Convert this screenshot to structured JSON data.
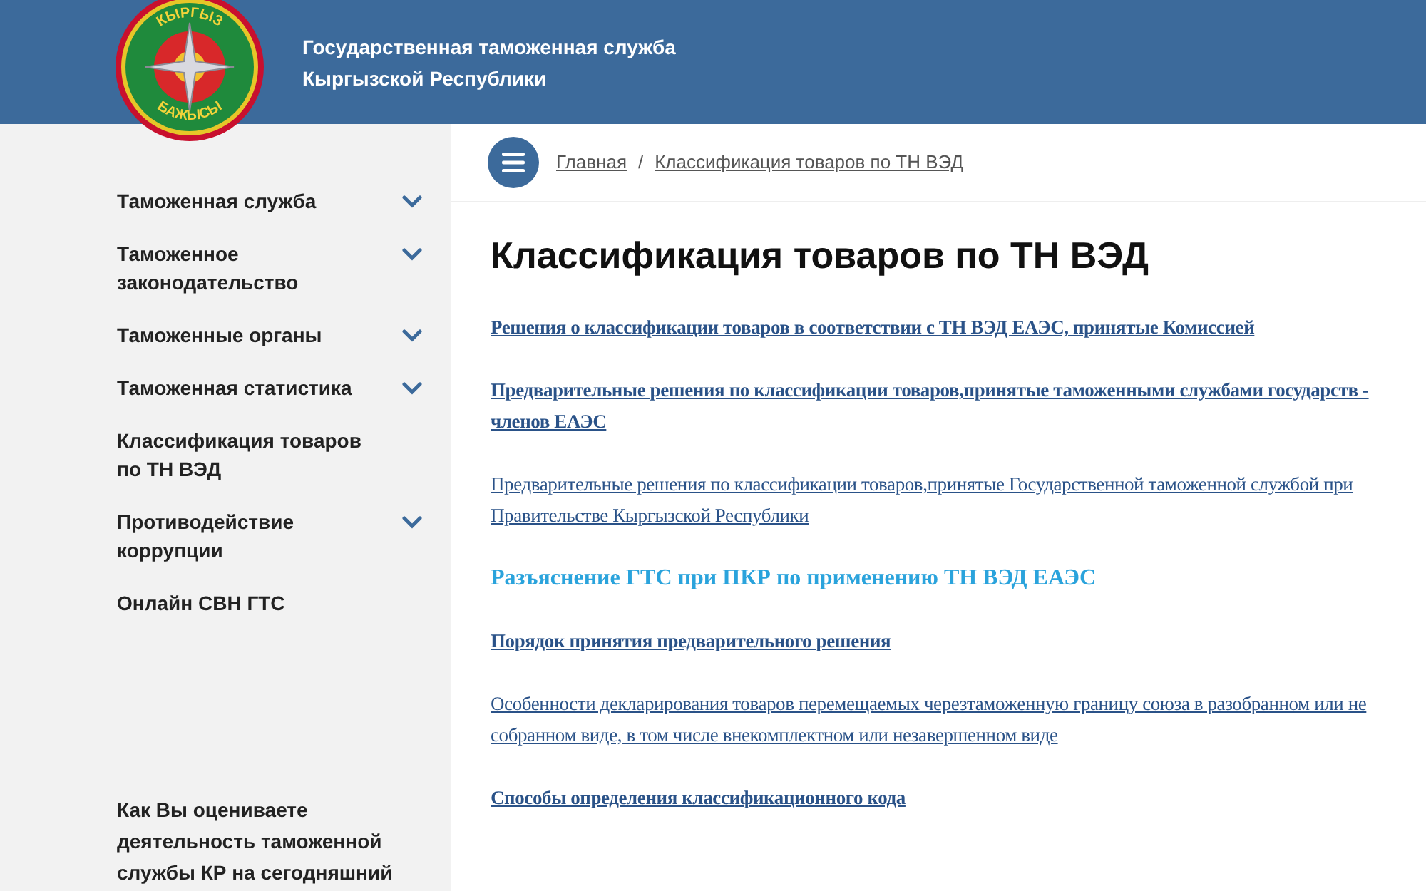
{
  "header": {
    "logo": {
      "top_text": "КЫРГЫЗ",
      "bottom_text": "БАЖЫСЫ"
    },
    "title_lines": [
      "Государственная таможенная служба",
      "Кыргызской Республики"
    ]
  },
  "sidebar": {
    "items": [
      {
        "label": "Таможенная служба",
        "expandable": true
      },
      {
        "label": "Таможенное законодательство",
        "expandable": true
      },
      {
        "label": "Таможенные органы",
        "expandable": true
      },
      {
        "label": "Таможенная статистика",
        "expandable": true
      },
      {
        "label": "Классификация товаров по ТН ВЭД",
        "expandable": false
      },
      {
        "label": "Противодействие коррупции",
        "expandable": true
      },
      {
        "label": "Онлайн СВН ГТС",
        "expandable": false
      }
    ],
    "poll_question": "Как Вы оцениваете деятельность таможенной службы КР на сегодняшний"
  },
  "breadcrumbs": [
    "Главная",
    "Классификация товаров по ТН ВЭД"
  ],
  "breadcrumb_separator": "/",
  "page_title": "Классификация товаров по ТН ВЭД",
  "links": [
    {
      "kind": "bold",
      "text": "Решения о классификации товаров в соответствии с ТН ВЭД ЕАЭС, принятые Комиссией"
    },
    {
      "kind": "bold",
      "text": "Предварительные решения по классификации товаров,принятые таможенными службами государств - членов ЕАЭС"
    },
    {
      "kind": "regular",
      "text": "Предварительные решения по классификации товаров,принятые Государственной таможенной службой при Правительстве Кыргызской Республики"
    },
    {
      "kind": "heading",
      "text": "Разъяснение ГТС при ПКР по применению ТН ВЭД ЕАЭС"
    },
    {
      "kind": "bold",
      "text": "Порядок принятия предварительного решения"
    },
    {
      "kind": "regular",
      "text": "Особенности декларирования товаров перемещаемых черезтаможенную границу союза в разобранном или не собранном виде, в том числе внекомплектном или незавершенном виде"
    },
    {
      "kind": "bold",
      "text": "Способы определения классификационного кода"
    }
  ]
}
